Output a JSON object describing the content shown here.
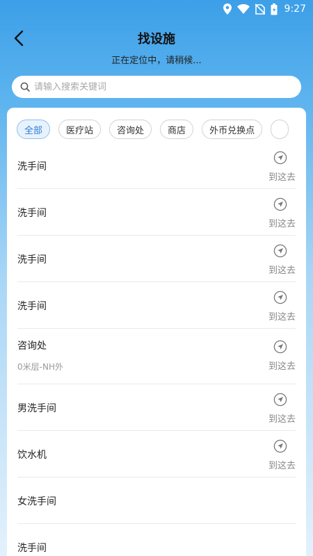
{
  "status_bar": {
    "time": "9:27",
    "icons": [
      "location-icon",
      "wifi-icon",
      "no-sim-icon",
      "battery-icon"
    ]
  },
  "header": {
    "title": "找设施",
    "subtitle": "正在定位中，请稍候..."
  },
  "search": {
    "placeholder": "请输入搜索关键词",
    "value": ""
  },
  "categories": [
    {
      "label": "全部",
      "active": true
    },
    {
      "label": "医疗站",
      "active": false
    },
    {
      "label": "咨询处",
      "active": false
    },
    {
      "label": "商店",
      "active": false
    },
    {
      "label": "外币兑换点",
      "active": false
    }
  ],
  "facilities": [
    {
      "name": "洗手间",
      "floor": "",
      "action": "到这去"
    },
    {
      "name": "洗手间",
      "floor": "",
      "action": "到这去"
    },
    {
      "name": "洗手间",
      "floor": "",
      "action": "到这去"
    },
    {
      "name": "洗手间",
      "floor": "",
      "action": "到这去"
    },
    {
      "name": "咨询处",
      "floor": "0米层-NH外",
      "action": "到这去"
    },
    {
      "name": "男洗手间",
      "floor": "",
      "action": "到这去"
    },
    {
      "name": "饮水机",
      "floor": "",
      "action": "到这去"
    },
    {
      "name": "女洗手间",
      "floor": "",
      "action": ""
    },
    {
      "name": "洗手间",
      "floor": "",
      "action": ""
    }
  ],
  "colors": {
    "accent": "#2a7fd4",
    "header_gradient_top": "#3c9fe8",
    "chip_active_bg": "#e8f2fd"
  }
}
